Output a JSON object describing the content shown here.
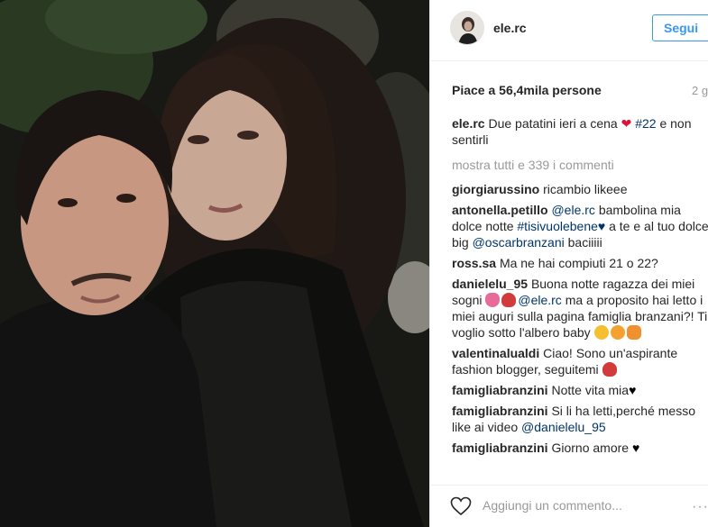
{
  "post": {
    "username": "ele.rc",
    "follow_label": "Segui",
    "likes": "Piace a 56,4mila persone",
    "time_ago": "2 g",
    "caption": {
      "user": "ele.rc",
      "text_part1": "Due patatini ieri a cena",
      "heart": "❤",
      "hashtag": "#22",
      "text_part2": "e non sentirli"
    },
    "load_more": "mostra tutti e 339 i commenti",
    "comments": [
      {
        "user": "giorgiarussino",
        "text": "ricambio likeee"
      },
      {
        "user": "antonella.petillo",
        "mention1": "@ele.rc",
        "text1": "bambolina mia dolce notte",
        "hashtag": "#tisivuolebene",
        "text2": "a te e al tuo dolce big",
        "mention2": "@oscarbranzani",
        "text3": "baciiiii"
      },
      {
        "user": "ross.sa",
        "text": "Ma ne hai compiuti 21 o 22?"
      },
      {
        "user": "danielelu_95",
        "text1": "Buona notte ragazza dei miei sogni",
        "mention": "@ele.rc",
        "text2": "ma a proposito hai letto i miei auguri sulla pagina famiglia branzani?! Ti voglio sotto l'albero baby"
      },
      {
        "user": "valentinalualdi",
        "text": "Ciao! Sono un'aspirante fashion blogger, seguitemi"
      },
      {
        "user": "famigliabranzini",
        "text": "Notte vita mia"
      },
      {
        "user": "famigliabranzini",
        "text": "Si li ha letti,perché messo like ai video",
        "mention": "@danielelu_95"
      },
      {
        "user": "famigliabranzini",
        "text": "Giorno amore"
      }
    ],
    "add_comment_placeholder": "Aggiungi un commento...",
    "more_label": "···"
  },
  "icons": {
    "heart_outline": "heart-outline-icon",
    "more": "more-options-icon",
    "red_heart": "red-heart-icon",
    "rose": "rose-emoji-icon",
    "tulip": "tulip-emoji-icon",
    "black_heart": "black-heart-icon"
  },
  "colors": {
    "link": "#003569",
    "follow": "#3897f0",
    "muted": "#999999",
    "text": "#262626"
  }
}
